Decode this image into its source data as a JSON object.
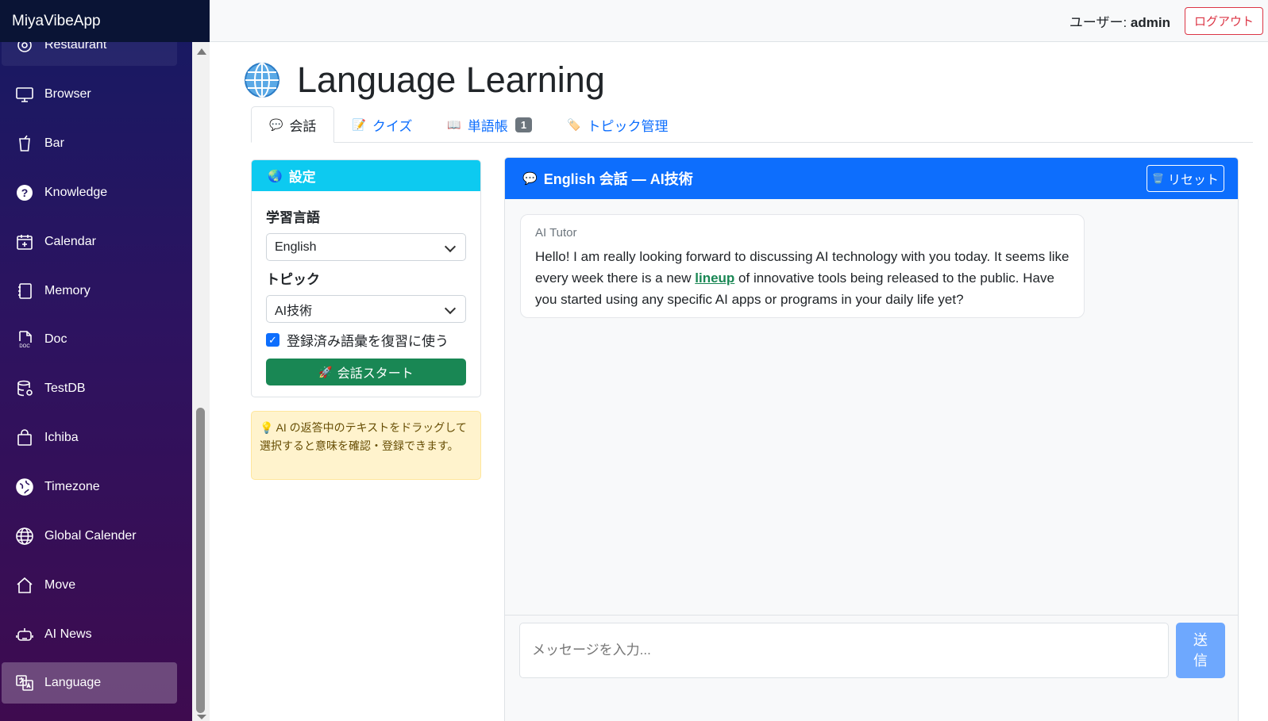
{
  "app": {
    "brand": "MiyaVibeApp"
  },
  "header": {
    "user_prefix": "ユーザー: ",
    "username": "admin",
    "logout_label": "ログアウト"
  },
  "sidebar": {
    "items": [
      {
        "label": "Restaurant",
        "icon": "restaurant-icon"
      },
      {
        "label": "Browser",
        "icon": "monitor-icon"
      },
      {
        "label": "Bar",
        "icon": "cup-icon"
      },
      {
        "label": "Knowledge",
        "icon": "question-circle-icon"
      },
      {
        "label": "Calendar",
        "icon": "calendar-plus-icon"
      },
      {
        "label": "Memory",
        "icon": "journals-icon"
      },
      {
        "label": "Doc",
        "icon": "doc-file-icon"
      },
      {
        "label": "TestDB",
        "icon": "database-icon"
      },
      {
        "label": "Ichiba",
        "icon": "bag-icon"
      },
      {
        "label": "Timezone",
        "icon": "globe-americas-icon"
      },
      {
        "label": "Global Calender",
        "icon": "globe-icon"
      },
      {
        "label": "Move",
        "icon": "house-icon"
      },
      {
        "label": "AI News",
        "icon": "robot-icon"
      },
      {
        "label": "Language",
        "icon": "translate-icon"
      }
    ],
    "active": "Language"
  },
  "page": {
    "title": "Language Learning",
    "title_icon": "globe-emoji-icon"
  },
  "tabs": [
    {
      "label": "会話",
      "emoji": "💬",
      "active": true
    },
    {
      "label": "クイズ",
      "emoji": "📝"
    },
    {
      "label": "単語帳",
      "emoji": "📖",
      "badge": "1"
    },
    {
      "label": "トピック管理",
      "emoji": "🏷️"
    }
  ],
  "settings": {
    "header": "設定",
    "header_emoji": "🌏",
    "language_label": "学習言語",
    "language_value": "English",
    "topic_label": "トピック",
    "topic_value": "AI技術",
    "review_checkbox_label": "登録済み語彙を復習に使う",
    "review_checked": true,
    "start_label": "会話スタート",
    "start_emoji": "🚀"
  },
  "hint": {
    "emoji": "💡",
    "text": "AI の返答中のテキストをドラッグして選択すると意味を確認・登録できます。"
  },
  "chat": {
    "header_emoji": "💬",
    "header": "English 会話 — AI技術",
    "reset_emoji": "🗑️",
    "reset_label": "リセット",
    "messages": [
      {
        "sender": "AI Tutor",
        "text_before": "Hello! I am really looking forward to discussing AI technology with you today. It seems like every week there is a new ",
        "highlight": "lineup",
        "text_after": " of innovative tools being released to the public. Have you started using any specific AI apps or programs in your daily life yet?"
      }
    ],
    "input_placeholder": "メッセージを入力...",
    "send_label": "送信"
  },
  "colors": {
    "primary": "#0d6efd",
    "info": "#0dcaf0",
    "success": "#198754",
    "danger": "#dc3545",
    "warning_bg": "#fff3cd"
  }
}
